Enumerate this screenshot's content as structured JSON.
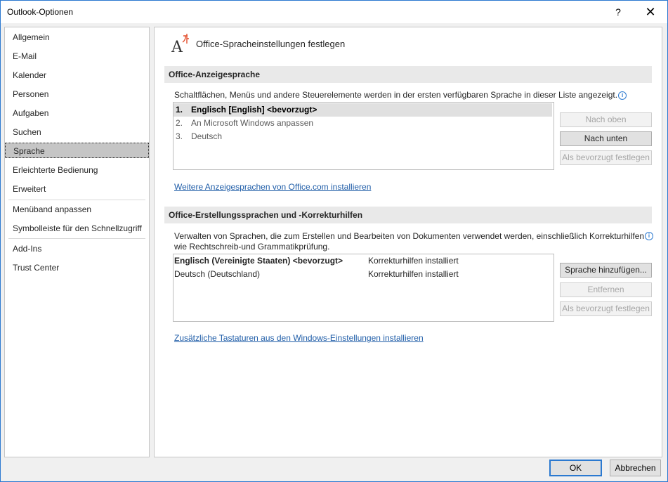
{
  "window": {
    "title": "Outlook-Optionen",
    "help": "?",
    "close": "✕"
  },
  "sidebar": {
    "items": [
      "Allgemein",
      "E-Mail",
      "Kalender",
      "Personen",
      "Aufgaben",
      "Suchen",
      "Sprache",
      "Erleichterte Bedienung",
      "Erweitert",
      "Menüband anpassen",
      "Symbolleiste für den Schnellzugriff",
      "Add-Ins",
      "Trust Center"
    ],
    "selected": "Sprache"
  },
  "page": {
    "title": "Office-Spracheinstellungen festlegen"
  },
  "display_section": {
    "header": "Office-Anzeigesprache",
    "description": "Schaltflächen, Menüs und andere Steuerelemente werden in der ersten verfügbaren Sprache in dieser Liste angezeigt.",
    "languages": [
      {
        "num": "1.",
        "label": "Englisch [English] <bevorzugt>"
      },
      {
        "num": "2.",
        "label": "An Microsoft Windows anpassen"
      },
      {
        "num": "3.",
        "label": "Deutsch"
      }
    ],
    "buttons": {
      "up": "Nach oben",
      "down": "Nach unten",
      "preferred": "Als bevorzugt festlegen"
    },
    "link": "Weitere Anzeigesprachen von Office.com installieren"
  },
  "authoring_section": {
    "header": "Office-Erstellungssprachen und -Korrekturhilfen",
    "description_line1": "Verwalten von Sprachen, die zum Erstellen und Bearbeiten von Dokumenten verwendet werden, einschließlich Korrekturhilfen",
    "description_line2": "wie Rechtschreib-und Grammatikprüfung.",
    "languages": [
      {
        "name": "Englisch (Vereinigte Staaten) <bevorzugt>",
        "status": "Korrekturhilfen installiert"
      },
      {
        "name": "Deutsch (Deutschland)",
        "status": "Korrekturhilfen installiert"
      }
    ],
    "buttons": {
      "add": "Sprache hinzufügen...",
      "remove": "Entfernen",
      "preferred": "Als bevorzugt festlegen"
    },
    "link": "Zusätzliche Tastaturen aus den Windows-Einstellungen installieren"
  },
  "footer": {
    "ok": "OK",
    "cancel": "Abbrechen"
  },
  "icons": {
    "language": "language-icon",
    "info": "info-icon"
  },
  "colors": {
    "accent": "#2b79d0",
    "link": "#1f5da8",
    "selection": "#c5c5c5"
  }
}
